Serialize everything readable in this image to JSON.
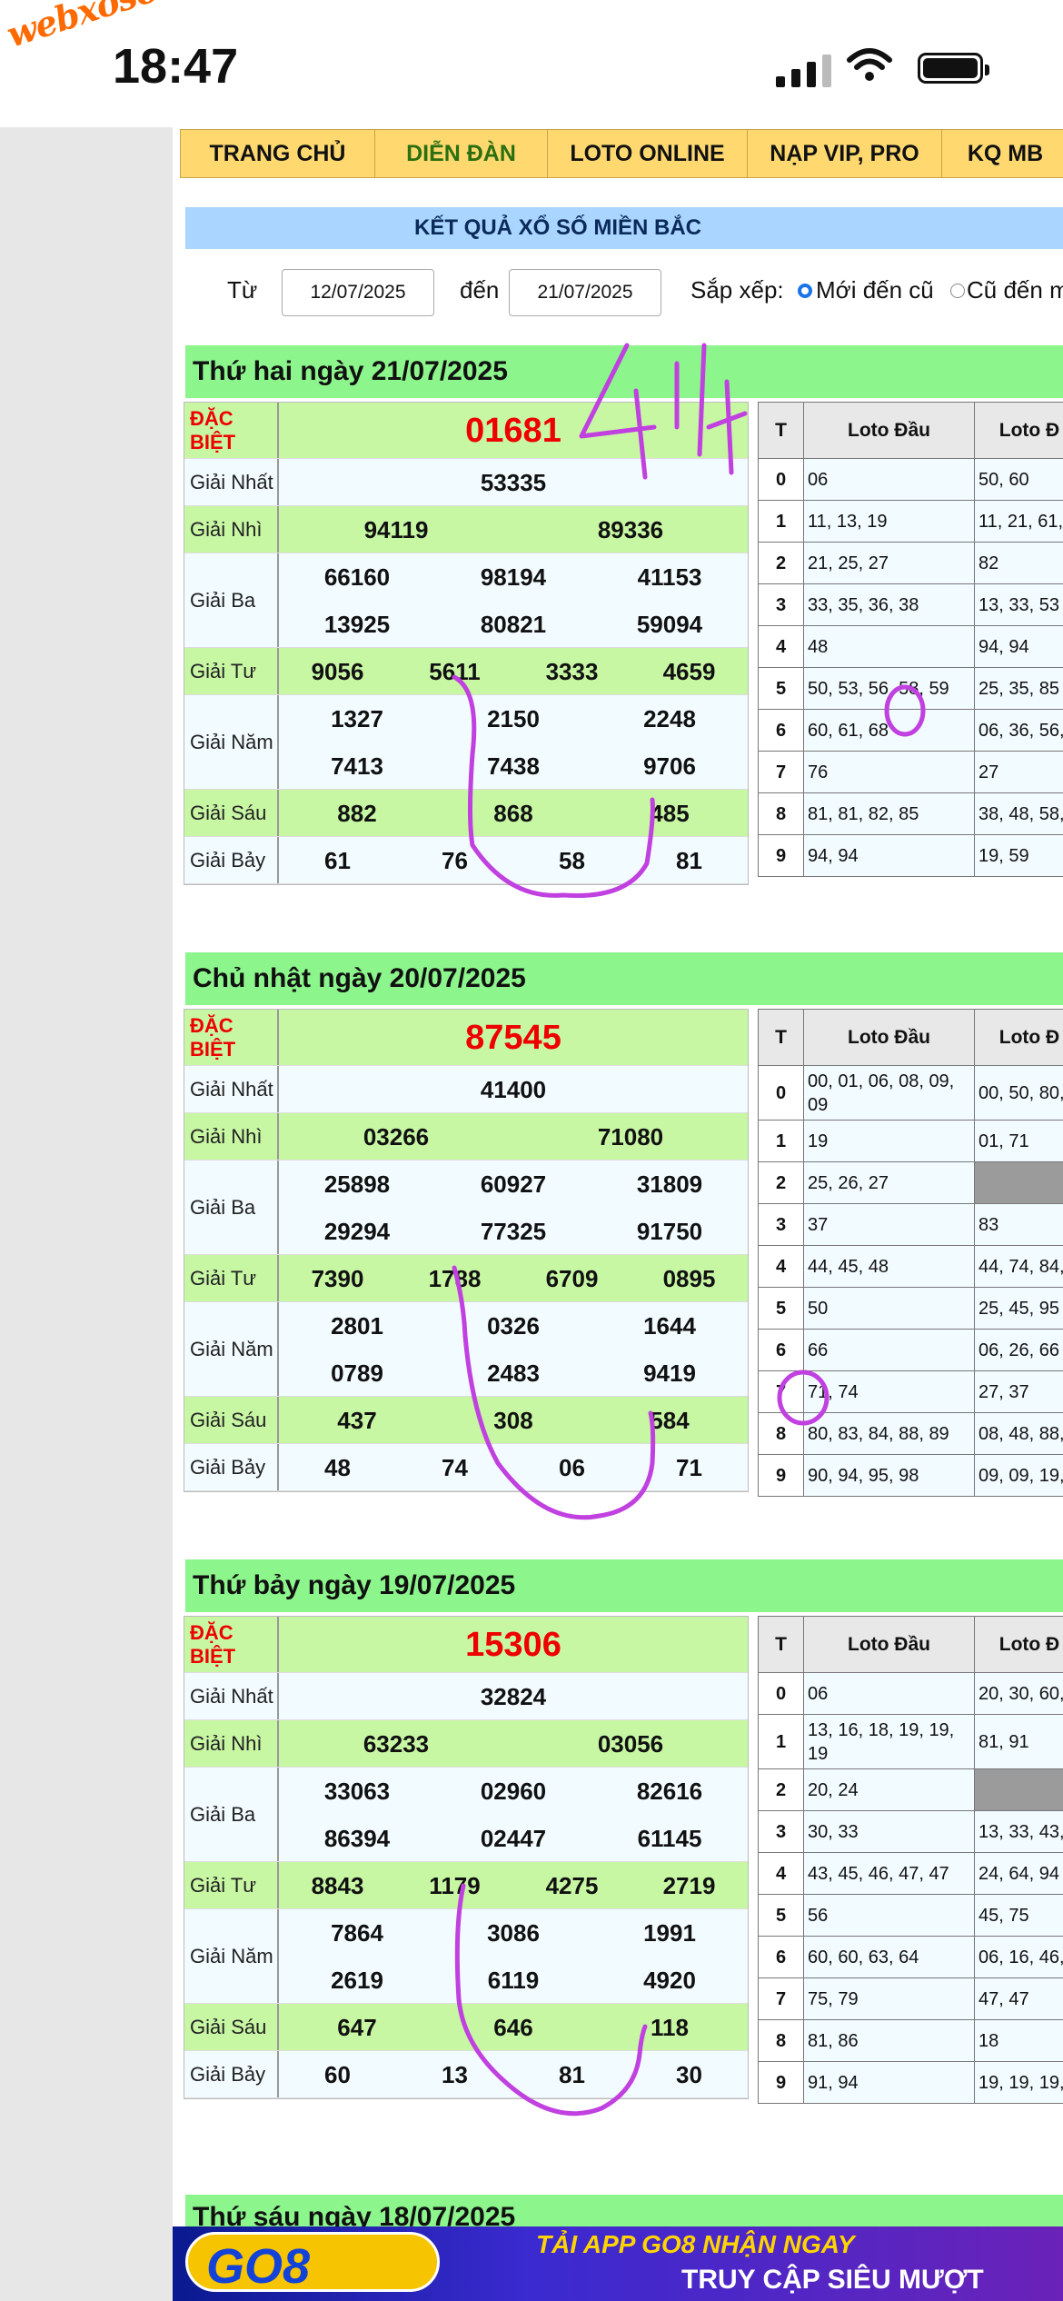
{
  "status_bar": {
    "watermark": "webxoso.net",
    "time": "18:47"
  },
  "nav": {
    "items": [
      "TRANG CHỦ",
      "DIỄN ĐÀN",
      "LOTO ONLINE",
      "NẠP VIP, PRO",
      "KQ MB"
    ]
  },
  "page_title": "KẾT QUẢ XỔ SỐ MIỀN BẮC",
  "filter": {
    "from_label": "Từ",
    "from_value": "12/07/2025",
    "to_label": "đến",
    "to_value": "21/07/2025",
    "sort_label": "Sắp xếp:",
    "opt_new": "Mới đến cũ",
    "opt_old": "Cũ đến m"
  },
  "loto_headers": {
    "t": "T",
    "dau": "Loto Đầu",
    "duoi": "Loto Đ"
  },
  "prize_labels": {
    "db": "ĐẶC BIỆT",
    "g1": "Giải Nhất",
    "g2": "Giải Nhì",
    "g3": "Giải Ba",
    "g4": "Giải Tư",
    "g5": "Giải Năm",
    "g6": "Giải Sáu",
    "g7": "Giải Bảy"
  },
  "days": [
    {
      "title": "Thứ hai ngày 21/07/2025",
      "db": "01681",
      "g1": "53335",
      "g2": [
        "94119",
        "89336"
      ],
      "g3": [
        "66160",
        "98194",
        "41153",
        "13925",
        "80821",
        "59094"
      ],
      "g4": [
        "9056",
        "5611",
        "3333",
        "4659"
      ],
      "g5": [
        "1327",
        "2150",
        "2248",
        "7413",
        "7438",
        "9706"
      ],
      "g6": [
        "882",
        "868",
        "485"
      ],
      "g7": [
        "61",
        "76",
        "58",
        "81"
      ],
      "loto": [
        [
          "0",
          "06",
          "50, 60"
        ],
        [
          "1",
          "11, 13, 19",
          "11, 21, 61,"
        ],
        [
          "2",
          "21, 25, 27",
          "82"
        ],
        [
          "3",
          "33, 35, 36, 38",
          "13, 33, 53"
        ],
        [
          "4",
          "48",
          "94, 94"
        ],
        [
          "5",
          "50, 53, 56, 58, 59",
          "25, 35, 85"
        ],
        [
          "6",
          "60, 61, 68",
          "06, 36, 56,"
        ],
        [
          "7",
          "76",
          "27"
        ],
        [
          "8",
          "81, 81, 82, 85",
          "38, 48, 58,"
        ],
        [
          "9",
          "94, 94",
          "19, 59"
        ]
      ]
    },
    {
      "title": "Chủ nhật ngày 20/07/2025",
      "db": "87545",
      "g1": "41400",
      "g2": [
        "03266",
        "71080"
      ],
      "g3": [
        "25898",
        "60927",
        "31809",
        "29294",
        "77325",
        "91750"
      ],
      "g4": [
        "7390",
        "1788",
        "6709",
        "0895"
      ],
      "g5": [
        "2801",
        "0326",
        "1644",
        "0789",
        "2483",
        "9419"
      ],
      "g6": [
        "437",
        "308",
        "584"
      ],
      "g7": [
        "48",
        "74",
        "06",
        "71"
      ],
      "loto": [
        [
          "0",
          "00, 01, 06, 08, 09, 09",
          "00, 50, 80,"
        ],
        [
          "1",
          "19",
          "01, 71"
        ],
        [
          "2",
          "25, 26, 27",
          ""
        ],
        [
          "3",
          "37",
          "83"
        ],
        [
          "4",
          "44, 45, 48",
          "44, 74, 84,"
        ],
        [
          "5",
          "50",
          "25, 45, 95"
        ],
        [
          "6",
          "66",
          "06, 26, 66"
        ],
        [
          "7",
          "71, 74",
          "27, 37"
        ],
        [
          "8",
          "80, 83, 84, 88, 89",
          "08, 48, 88,"
        ],
        [
          "9",
          "90, 94, 95, 98",
          "09, 09, 19,"
        ]
      ]
    },
    {
      "title": "Thứ bảy ngày 19/07/2025",
      "db": "15306",
      "g1": "32824",
      "g2": [
        "63233",
        "03056"
      ],
      "g3": [
        "33063",
        "02960",
        "82616",
        "86394",
        "02447",
        "61145"
      ],
      "g4": [
        "8843",
        "1179",
        "4275",
        "2719"
      ],
      "g5": [
        "7864",
        "3086",
        "1991",
        "2619",
        "6119",
        "4920"
      ],
      "g6": [
        "647",
        "646",
        "118"
      ],
      "g7": [
        "60",
        "13",
        "81",
        "30"
      ],
      "loto": [
        [
          "0",
          "06",
          "20, 30, 60,"
        ],
        [
          "1",
          "13, 16, 18, 19, 19, 19",
          "81, 91"
        ],
        [
          "2",
          "20, 24",
          ""
        ],
        [
          "3",
          "30, 33",
          "13, 33, 43,"
        ],
        [
          "4",
          "43, 45, 46, 47, 47",
          "24, 64, 94"
        ],
        [
          "5",
          "56",
          "45, 75"
        ],
        [
          "6",
          "60, 60, 63, 64",
          "06, 16, 46,"
        ],
        [
          "7",
          "75, 79",
          "47, 47"
        ],
        [
          "8",
          "81, 86",
          "18"
        ],
        [
          "9",
          "91, 94",
          "19, 19, 19,"
        ]
      ]
    }
  ],
  "next_day_title": "Thứ sáu ngày 18/07/2025",
  "banner": {
    "brand": "GO8",
    "line1": "TẢI APP GO8 NHẬN NGAY",
    "line2": "TRUY CẬP SIÊU MƯỢT"
  },
  "handwriting": "414",
  "colors": {
    "nav_bg": "#ffd970",
    "title_bg": "#a9d5ff",
    "day_bg": "#8cf58c",
    "row_green": "#c8f7a4",
    "db_red": "#e00000",
    "annotation": "#c040e0"
  }
}
